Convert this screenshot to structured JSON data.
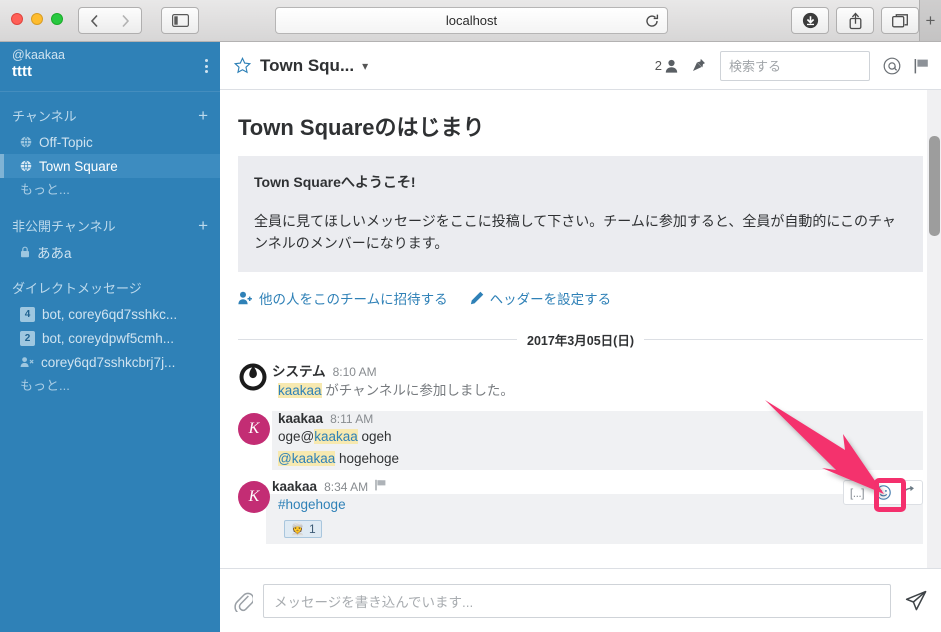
{
  "browser": {
    "url": "localhost",
    "buttons": {
      "back": "back-arrow",
      "forward": "forward-arrow",
      "sidebar": "sidebar-toggle-icon",
      "reload": "reload-icon",
      "download": "download-icon",
      "share": "share-icon",
      "tabs": "tab-overview-icon",
      "newtab": "+"
    }
  },
  "sidebar": {
    "user_handle": "@kaakaa",
    "team_name": "tttt",
    "menu_icon": "kebab-menu-icon",
    "sections": [
      {
        "title": "チャンネル",
        "add_label": "+",
        "items": [
          {
            "label": "Off-Topic",
            "icon": "globe-icon",
            "active": false
          },
          {
            "label": "Town Square",
            "icon": "globe-icon",
            "active": true
          }
        ],
        "more_label": "もっと..."
      },
      {
        "title": "非公開チャンネル",
        "add_label": "+",
        "items": [
          {
            "label": "ああа",
            "icon": "lock-icon",
            "active": false
          }
        ],
        "more_label": ""
      },
      {
        "title": "ダイレクトメッセージ",
        "add_label": "",
        "items": [
          {
            "label": "bot, corey6qd7sshkc...",
            "badge": "4",
            "icon": "badge",
            "active": false
          },
          {
            "label": "bot, coreydpwf5cmh...",
            "badge": "2",
            "icon": "badge",
            "active": false
          },
          {
            "label": "corey6qd7sshkcbrj7j...",
            "badge": "",
            "icon": "dm-offline-icon",
            "active": false
          }
        ],
        "more_label": "もっと..."
      }
    ]
  },
  "channel_header": {
    "star_icon": "star-icon",
    "title": "Town Squ...",
    "chevron": "▾",
    "member_count": "2",
    "member_icon": "member-icon",
    "pin_icon": "pin-icon",
    "search_placeholder": "検索する",
    "at_icon": "at-mention-icon",
    "flag_icon": "flag-icon"
  },
  "intro": {
    "title": "Town Squareのはじまり",
    "welcome": "Town Squareへようこそ!",
    "body": "全員に見てほしいメッセージをここに投稿して下さい。チームに参加すると、全員が自動的にこのチャンネルのメンバーになります。",
    "actions": [
      {
        "label": "他の人をこのチームに招待する",
        "icon": "add-user-icon"
      },
      {
        "label": "ヘッダーを設定する",
        "icon": "pencil-icon"
      }
    ]
  },
  "date_separator": "2017年3月05日(日)",
  "posts": [
    {
      "author": "システム",
      "time": "8:10 AM",
      "avatar_type": "mattermost-logo",
      "avatar_initial": "",
      "system": true,
      "lines": [
        {
          "segments": [
            {
              "text": "kaakaa",
              "style": "mention"
            },
            {
              "text": " がチャンネルに参加しました。",
              "style": "system"
            }
          ]
        }
      ],
      "reaction": null,
      "actions": false
    },
    {
      "author": "kaakaa",
      "time": "8:11 AM",
      "avatar_type": "initial",
      "avatar_initial": "K",
      "system": false,
      "lines": [
        {
          "segments": [
            {
              "text": "oge@",
              "style": "plain"
            },
            {
              "text": "kaakaa",
              "style": "mention"
            },
            {
              "text": " ogeh",
              "style": "plain"
            }
          ]
        },
        {
          "segments": [
            {
              "text": "@kaakaa",
              "style": "mention"
            },
            {
              "text": " hogehoge",
              "style": "plain"
            }
          ]
        }
      ],
      "reaction": null,
      "actions": false
    },
    {
      "author": "kaakaa",
      "time": "8:34 AM",
      "flag_icon": "flag-icon",
      "avatar_type": "initial",
      "avatar_initial": "K",
      "system": false,
      "lines": [
        {
          "segments": [
            {
              "text": "#hogehoge",
              "style": "hashtag"
            }
          ]
        }
      ],
      "reaction": {
        "emoji": "👳",
        "count": "1"
      },
      "actions": true,
      "action_buttons": [
        {
          "name": "more-actions",
          "label": "[...]"
        },
        {
          "name": "add-reaction",
          "label": "emoji-smiley-icon",
          "highlighted": true
        },
        {
          "name": "reply",
          "label": "reply-arrow-icon"
        }
      ]
    }
  ],
  "message_box": {
    "attach_icon": "paperclip-icon",
    "placeholder": "メッセージを書き込んでいます...",
    "send_icon": "send-icon"
  },
  "annotation": {
    "arrow_color": "#f4306d",
    "highlight_color": "#f4306d",
    "target": "add-reaction"
  },
  "colors": {
    "sidebar_bg": "#2f81b7",
    "sidebar_active": "#3d8cc0",
    "avatar": "#c32d74",
    "link": "#2f81b7",
    "accent": "#f4306d"
  }
}
